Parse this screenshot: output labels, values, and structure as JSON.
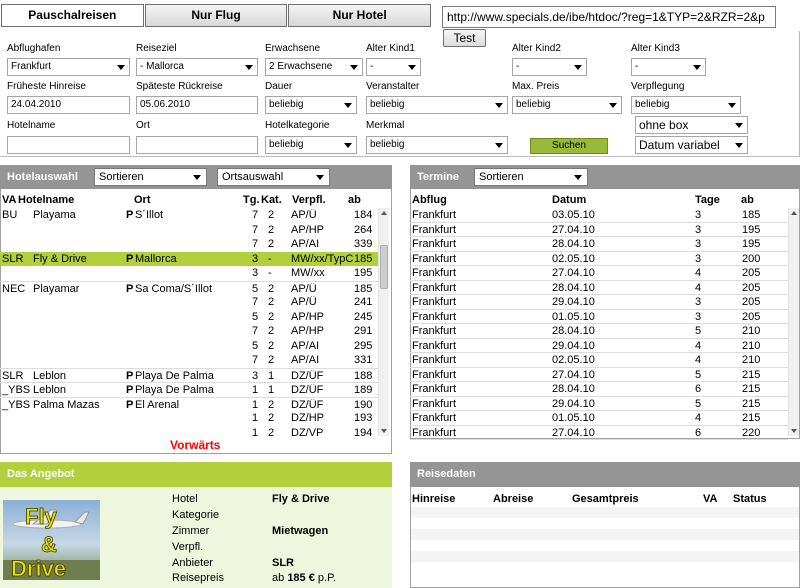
{
  "tabs": [
    "Pauschalreisen",
    "Nur Flug",
    "Nur Hotel"
  ],
  "url": "http://www.specials.de/ibe/htdoc/?reg=1&TYP=2&RZR=2&p",
  "test_label": "Test",
  "form": {
    "abflughafen": {
      "label": "Abflughafen",
      "value": "Frankfurt"
    },
    "reiseziel": {
      "label": "Reiseziel",
      "value": "- Mallorca"
    },
    "erwachsene": {
      "label": "Erwachsene",
      "value": "2 Erwachsene"
    },
    "kind1": {
      "label": "Alter Kind1",
      "value": "-"
    },
    "kind2": {
      "label": "Alter Kind2",
      "value": "-"
    },
    "kind3": {
      "label": "Alter Kind3",
      "value": "-"
    },
    "hinreise": {
      "label": "Früheste Hinreise",
      "value": "24.04.2010"
    },
    "rueckreise": {
      "label": "Späteste Rückreise",
      "value": "05.06.2010"
    },
    "dauer": {
      "label": "Dauer",
      "value": "beliebig"
    },
    "veranstalter": {
      "label": "Veranstalter",
      "value": "beliebig"
    },
    "maxpreis": {
      "label": "Max. Preis",
      "value": "beliebig"
    },
    "verpflegung": {
      "label": "Verpflegung",
      "value": "beliebig"
    },
    "hotelname": {
      "label": "Hotelname",
      "value": ""
    },
    "ort": {
      "label": "Ort",
      "value": ""
    },
    "hotelkategorie": {
      "label": "Hotelkategorie",
      "value": "beliebig"
    },
    "merkmal": {
      "label": "Merkmal",
      "value": "beliebig"
    },
    "suchen_label": "Suchen",
    "box": "ohne box",
    "datum": "Datum variabel"
  },
  "hotel": {
    "title": "Hotelauswahl",
    "sort": "Sortieren",
    "ortsauswahl": "Ortsauswahl",
    "columns": [
      "VA",
      "Hotelname",
      "Ort",
      "Tg.",
      "Kat.",
      "Verpfl.",
      "ab"
    ],
    "rows": [
      [
        "BU",
        "Playama",
        "P",
        "S´Illot",
        "7",
        "2",
        "AP/Ü",
        "184"
      ],
      [
        "",
        "",
        "",
        "",
        "7",
        "2",
        "AP/HP",
        "264"
      ],
      [
        "",
        "",
        "",
        "",
        "7",
        "2",
        "AP/AI",
        "339"
      ],
      [
        "SLR",
        "Fly & Drive",
        "P",
        "Mallorca",
        "3",
        "-",
        "MW/xx/TypC",
        "185"
      ],
      [
        "",
        "",
        "",
        "",
        "3",
        "-",
        "MW/xx",
        "195"
      ],
      [
        "NEC",
        "Playamar",
        "P",
        "Sa Coma/S´Illot",
        "5",
        "2",
        "AP/Ü",
        "185"
      ],
      [
        "",
        "",
        "",
        "",
        "7",
        "2",
        "AP/Ü",
        "241"
      ],
      [
        "",
        "",
        "",
        "",
        "5",
        "2",
        "AP/HP",
        "245"
      ],
      [
        "",
        "",
        "",
        "",
        "7",
        "2",
        "AP/HP",
        "291"
      ],
      [
        "",
        "",
        "",
        "",
        "5",
        "2",
        "AP/AI",
        "295"
      ],
      [
        "",
        "",
        "",
        "",
        "7",
        "2",
        "AP/AI",
        "331"
      ],
      [
        "SLR",
        "Leblon",
        "P",
        "Playa De Palma",
        "3",
        "1",
        "DZ/ÜF",
        "188"
      ],
      [
        "_YBS",
        "Leblon",
        "P",
        "Playa De Palma",
        "1",
        "1",
        "DZ/ÜF",
        "189"
      ],
      [
        "_YBS",
        "Palma Mazas",
        "P",
        "El Arenal",
        "1",
        "2",
        "DZ/ÜF",
        "190"
      ],
      [
        "",
        "",
        "",
        "",
        "1",
        "2",
        "DZ/HP",
        "193"
      ],
      [
        "",
        "",
        "",
        "",
        "1",
        "2",
        "DZ/VP",
        "194"
      ]
    ],
    "vorwaerts": "Vorwärts"
  },
  "termine": {
    "title": "Termine",
    "sort": "Sortieren",
    "columns": [
      "Abflug",
      "Datum",
      "Tage",
      "ab"
    ],
    "rows": [
      [
        "Frankfurt",
        "03.05.10",
        "3",
        "185"
      ],
      [
        "Frankfurt",
        "27.04.10",
        "3",
        "195"
      ],
      [
        "Frankfurt",
        "28.04.10",
        "3",
        "195"
      ],
      [
        "Frankfurt",
        "02.05.10",
        "3",
        "200"
      ],
      [
        "Frankfurt",
        "27.04.10",
        "4",
        "205"
      ],
      [
        "Frankfurt",
        "28.04.10",
        "4",
        "205"
      ],
      [
        "Frankfurt",
        "29.04.10",
        "3",
        "205"
      ],
      [
        "Frankfurt",
        "01.05.10",
        "3",
        "205"
      ],
      [
        "Frankfurt",
        "28.04.10",
        "5",
        "210"
      ],
      [
        "Frankfurt",
        "29.04.10",
        "4",
        "210"
      ],
      [
        "Frankfurt",
        "02.05.10",
        "4",
        "210"
      ],
      [
        "Frankfurt",
        "27.04.10",
        "5",
        "215"
      ],
      [
        "Frankfurt",
        "28.04.10",
        "6",
        "215"
      ],
      [
        "Frankfurt",
        "29.04.10",
        "5",
        "215"
      ],
      [
        "Frankfurt",
        "01.05.10",
        "4",
        "215"
      ],
      [
        "Frankfurt",
        "27.04.10",
        "6",
        "220"
      ]
    ]
  },
  "angebot": {
    "title": "Das Angebot",
    "logo_text": [
      "Fly",
      "&",
      "Drive"
    ],
    "labels": [
      "Hotel",
      "Kategorie",
      "Zimmer",
      "Verpfl.",
      "Anbieter",
      "Reisepreis"
    ],
    "hotel": "Fly & Drive",
    "zimmer": "Mietwagen",
    "anbieter": "SLR",
    "preis_prefix": "ab",
    "preis": "185 €",
    "preis_suffix": "p.P."
  },
  "reisedaten": {
    "title": "Reisedaten",
    "columns": [
      "Hinreise",
      "Abreise",
      "Gesamtpreis",
      "VA",
      "Status"
    ]
  }
}
